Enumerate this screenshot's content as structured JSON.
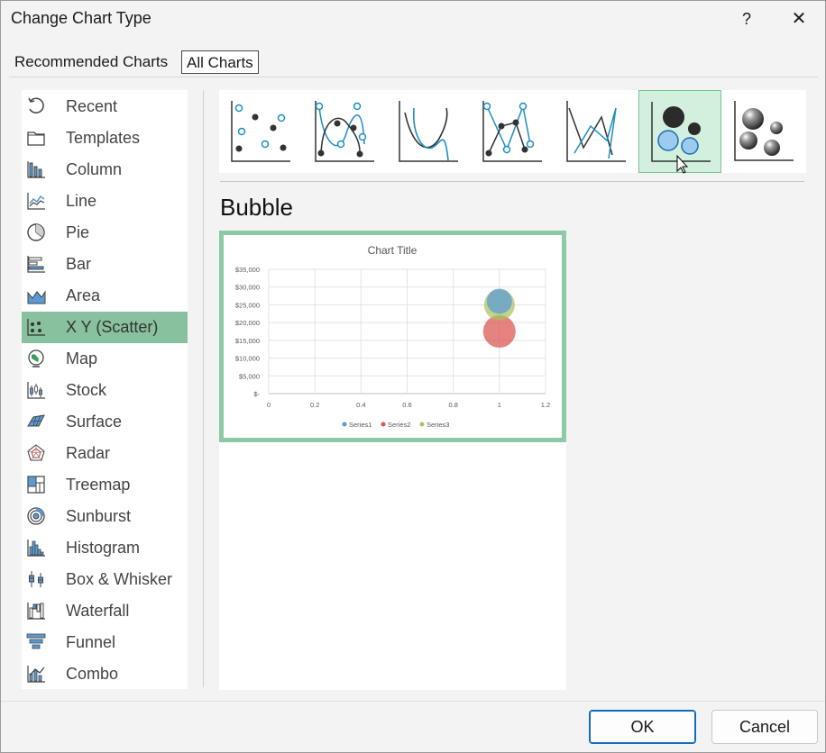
{
  "dialog": {
    "title": "Change Chart Type",
    "help_label": "?",
    "close_label": "✕"
  },
  "tabs": [
    {
      "label": "Recommended Charts",
      "active": false
    },
    {
      "label": "All Charts",
      "active": true
    }
  ],
  "sidebar": {
    "selected": "X Y (Scatter)",
    "items": [
      {
        "label": "Recent",
        "icon": "recent-icon"
      },
      {
        "label": "Templates",
        "icon": "templates-icon"
      },
      {
        "label": "Column",
        "icon": "column-chart-icon"
      },
      {
        "label": "Line",
        "icon": "line-chart-icon"
      },
      {
        "label": "Pie",
        "icon": "pie-chart-icon"
      },
      {
        "label": "Bar",
        "icon": "bar-chart-icon"
      },
      {
        "label": "Area",
        "icon": "area-chart-icon"
      },
      {
        "label": "X Y (Scatter)",
        "icon": "scatter-chart-icon"
      },
      {
        "label": "Map",
        "icon": "map-chart-icon"
      },
      {
        "label": "Stock",
        "icon": "stock-chart-icon"
      },
      {
        "label": "Surface",
        "icon": "surface-chart-icon"
      },
      {
        "label": "Radar",
        "icon": "radar-chart-icon"
      },
      {
        "label": "Treemap",
        "icon": "treemap-chart-icon"
      },
      {
        "label": "Sunburst",
        "icon": "sunburst-chart-icon"
      },
      {
        "label": "Histogram",
        "icon": "histogram-chart-icon"
      },
      {
        "label": "Box & Whisker",
        "icon": "box-whisker-chart-icon"
      },
      {
        "label": "Waterfall",
        "icon": "waterfall-chart-icon"
      },
      {
        "label": "Funnel",
        "icon": "funnel-chart-icon"
      },
      {
        "label": "Combo",
        "icon": "combo-chart-icon"
      }
    ]
  },
  "subtypes": {
    "selected": "bubble",
    "items": [
      {
        "name": "scatter",
        "icon": "scatter-markers-icon"
      },
      {
        "name": "scatter-smooth-lines-markers",
        "icon": "scatter-smooth-markers-icon"
      },
      {
        "name": "scatter-smooth-lines",
        "icon": "scatter-smooth-lines-icon"
      },
      {
        "name": "scatter-straight-lines-markers",
        "icon": "scatter-straight-markers-icon"
      },
      {
        "name": "scatter-straight-lines",
        "icon": "scatter-straight-lines-icon"
      },
      {
        "name": "bubble",
        "icon": "bubble-icon"
      },
      {
        "name": "3d-bubble",
        "icon": "bubble-3d-icon"
      }
    ]
  },
  "selected_type_heading": "Bubble",
  "chart_data": {
    "type": "scatter",
    "subtype": "bubble",
    "title": "Chart Title",
    "xlabel": "",
    "ylabel": "",
    "xlim": [
      0,
      1.2
    ],
    "ylim": [
      0,
      35000
    ],
    "x_ticks": [
      "0",
      "0.2",
      "0.4",
      "0.6",
      "0.8",
      "1",
      "1.2"
    ],
    "y_ticks": [
      "$-",
      "$5,000",
      "$10,000",
      "$15,000",
      "$20,000",
      "$25,000",
      "$30,000",
      "$35,000"
    ],
    "grid": true,
    "legend_position": "bottom",
    "series": [
      {
        "name": "Series1",
        "color": "#5b9bd5",
        "points": [
          {
            "x": 1,
            "y": 26000
          }
        ]
      },
      {
        "name": "Series2",
        "color": "#d9534f",
        "points": [
          {
            "x": 1,
            "y": 17500
          }
        ]
      },
      {
        "name": "Series3",
        "color": "#a9c45e",
        "points": [
          {
            "x": 1,
            "y": 25000
          }
        ]
      }
    ]
  },
  "buttons": {
    "ok_label": "OK",
    "cancel_label": "Cancel"
  }
}
